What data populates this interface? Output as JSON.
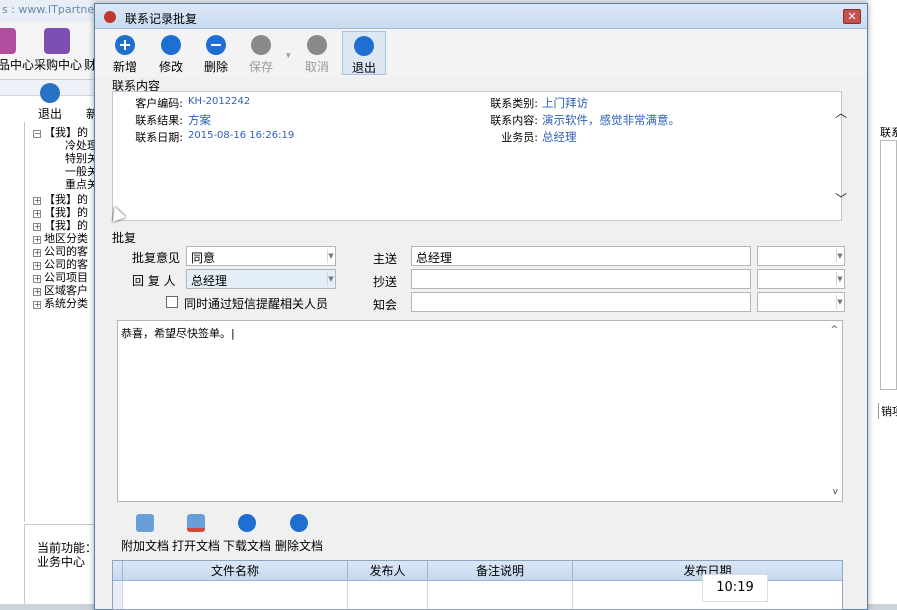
{
  "background": {
    "url_text": "s : www.ITpartner",
    "toolbar": [
      {
        "label": "品中心"
      },
      {
        "label": "采购中心"
      },
      {
        "label": "财"
      }
    ],
    "sub_toolbar": {
      "exit_label": "退出",
      "next_label": "新"
    },
    "tree": [
      {
        "box": "−",
        "text": "【我】的"
      },
      {
        "box": "",
        "text": "冷处理"
      },
      {
        "box": "",
        "text": "特别关"
      },
      {
        "box": "",
        "text": "一般关"
      },
      {
        "box": "",
        "text": "重点关"
      },
      {
        "box": "+",
        "text": "【我】的"
      },
      {
        "box": "+",
        "text": "【我】的"
      },
      {
        "box": "+",
        "text": "【我】的"
      },
      {
        "box": "+",
        "text": "地区分类"
      },
      {
        "box": "+",
        "text": "公司的客"
      },
      {
        "box": "+",
        "text": "公司的客"
      },
      {
        "box": "+",
        "text": "公司项目"
      },
      {
        "box": "+",
        "text": "区域客户"
      },
      {
        "box": "+",
        "text": "系统分类"
      }
    ],
    "current_function_label": "当前功能：",
    "current_function_value": "业务中心",
    "right_pane": {
      "label": "联系",
      "tab": "销项"
    }
  },
  "dialog": {
    "title": "联系记录批复",
    "close_symbol": "✕",
    "toolbar": [
      {
        "label": "新增",
        "icon": "add-icon",
        "enabled": true
      },
      {
        "label": "修改",
        "icon": "edit-icon",
        "enabled": true
      },
      {
        "label": "删除",
        "icon": "delete-icon",
        "enabled": true
      },
      {
        "label": "保存",
        "icon": "save-icon",
        "enabled": false
      },
      {
        "label": "取消",
        "icon": "cancel-icon",
        "enabled": false
      },
      {
        "label": "退出",
        "icon": "exit-icon",
        "enabled": true
      }
    ],
    "contact": {
      "section_label": "联系内容",
      "customer_code_label": "客户编码:",
      "customer_code": "KH-2012242",
      "result_label": "联系结果:",
      "result": "方案",
      "date_label": "联系日期:",
      "date": "2015-08-16 16:26:19",
      "type_label": "联系类别:",
      "type": "上门拜访",
      "content_label": "联系内容:",
      "content": "演示软件，感觉非常满意。",
      "salesman_label": "业务员:",
      "salesman": "总经理"
    },
    "approval": {
      "section_label": "批复",
      "opinion_label": "批复意见",
      "opinion_value": "同意",
      "replier_label": "回 复 人",
      "replier_value": "总经理",
      "sms_checkbox_label": "同时通过短信提醒相关人员",
      "sms_checked": false,
      "main_send_label": "主送",
      "main_send_value": "总经理",
      "cc_label": "抄送",
      "cc_value": "",
      "notify_label": "知会",
      "notify_value": "",
      "memo_text": "恭喜，希望尽快签单。|"
    },
    "documents": {
      "buttons": [
        {
          "label": "附加文档",
          "icon": "attach-doc-icon"
        },
        {
          "label": "打开文档",
          "icon": "open-doc-icon"
        },
        {
          "label": "下载文档",
          "icon": "download-doc-icon"
        },
        {
          "label": "删除文档",
          "icon": "delete-doc-icon"
        }
      ],
      "columns": [
        "文件名称",
        "发布人",
        "备注说明",
        "发布日期"
      ]
    }
  },
  "system_clock": "10:19"
}
